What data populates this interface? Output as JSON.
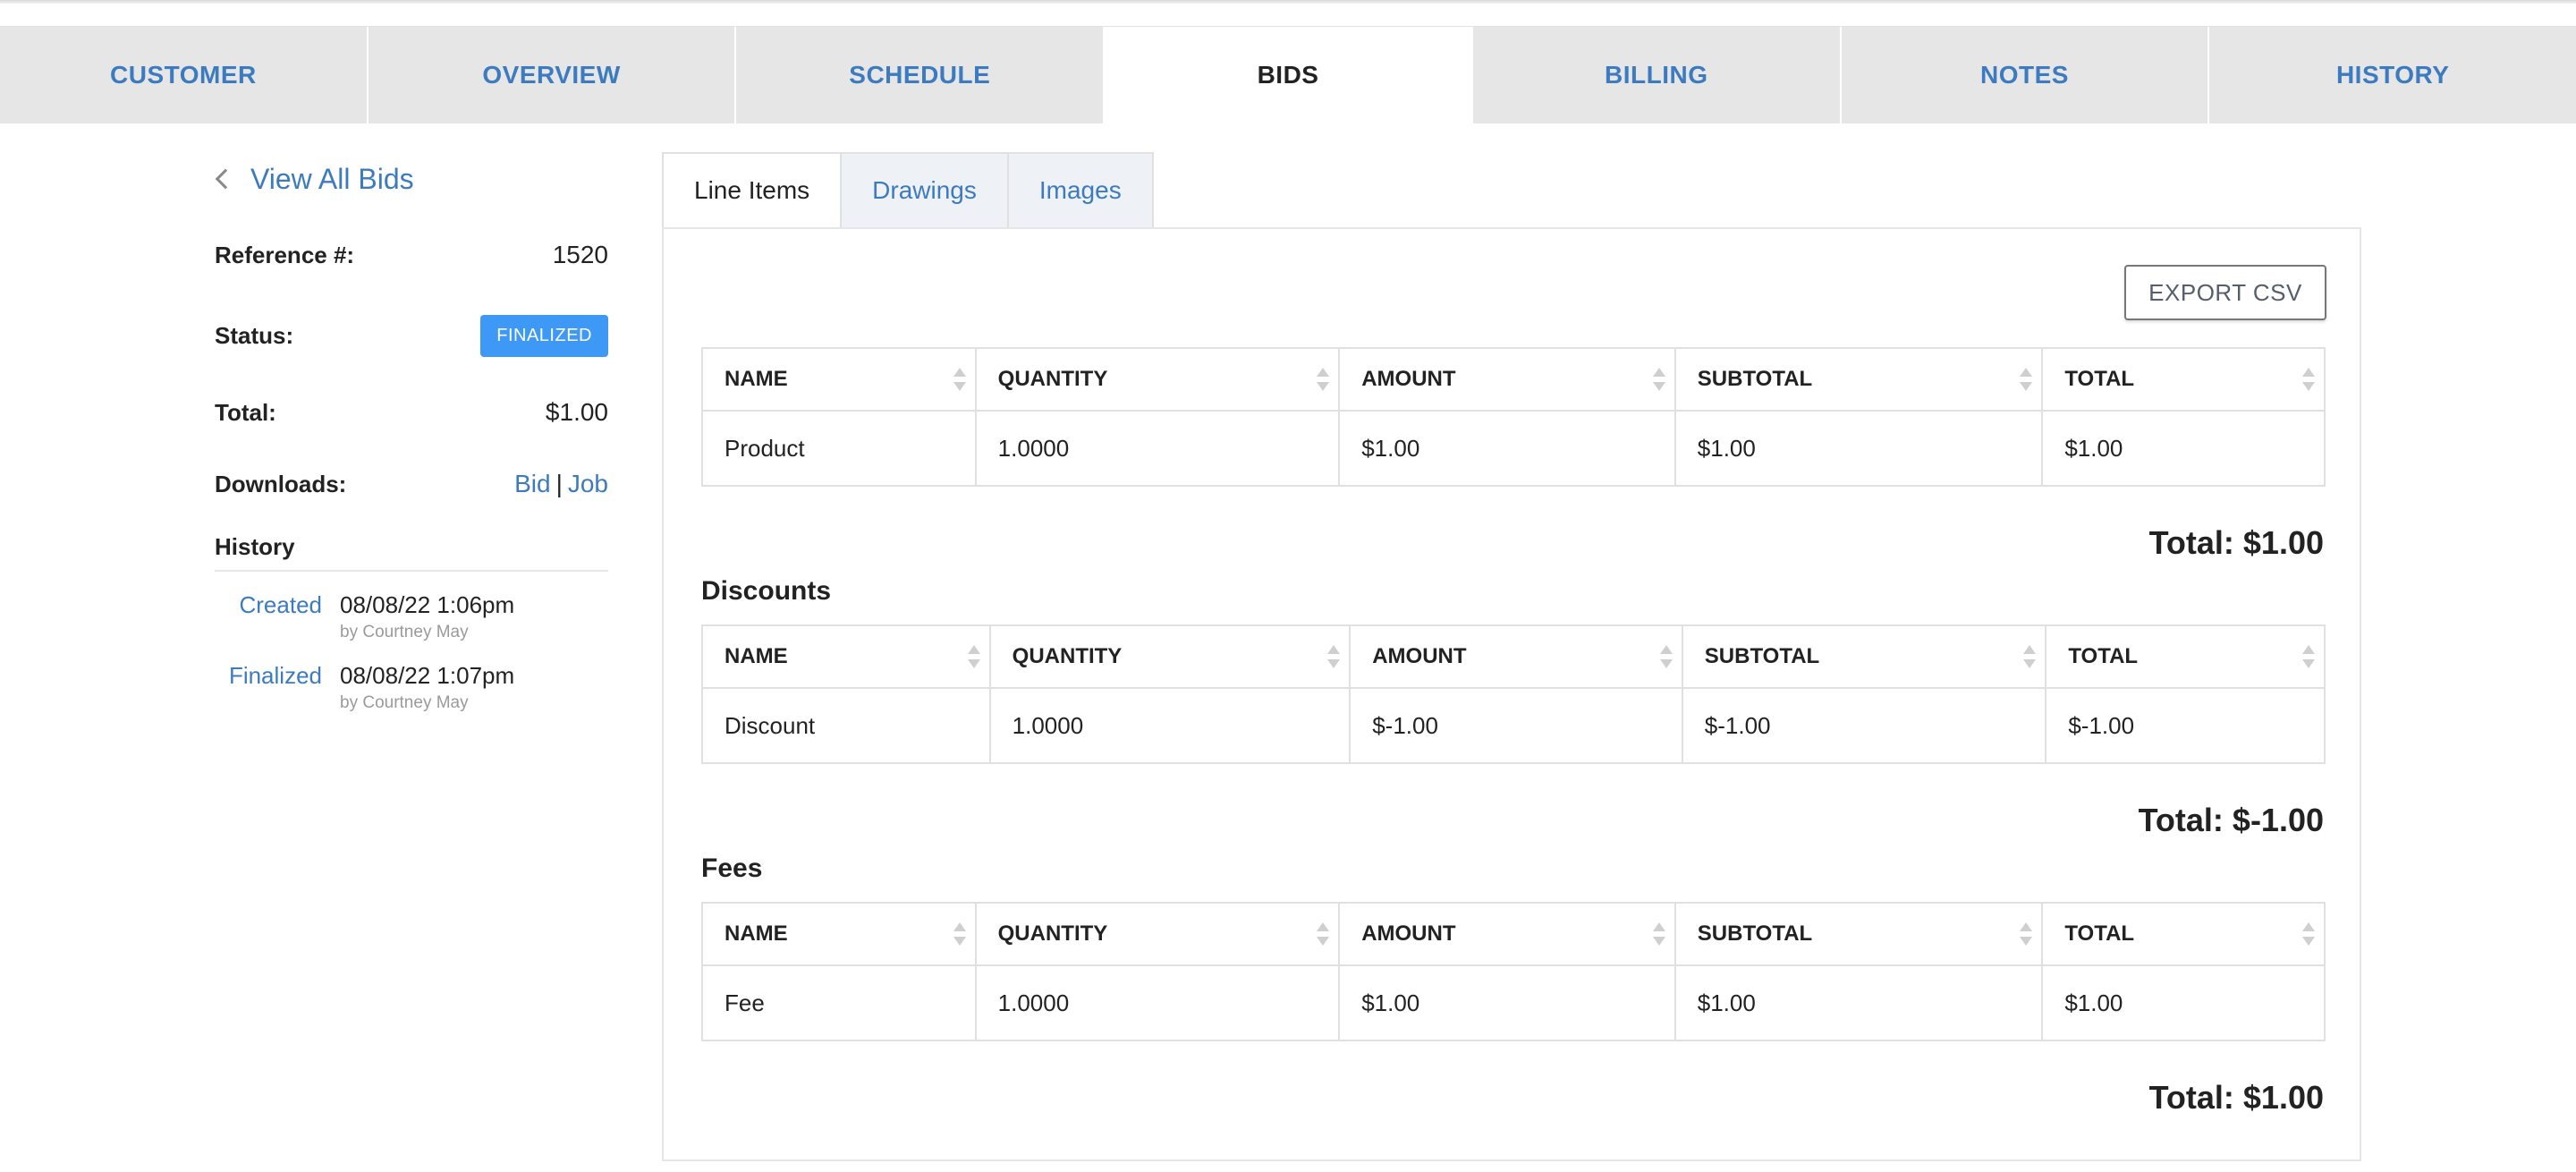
{
  "nav": {
    "tabs": [
      "CUSTOMER",
      "OVERVIEW",
      "SCHEDULE",
      "BIDS",
      "BILLING",
      "NOTES",
      "HISTORY"
    ],
    "active": "BIDS"
  },
  "left": {
    "back_label": "View All Bids",
    "reference_label": "Reference #:",
    "reference_value": "1520",
    "status_label": "Status:",
    "status_value": "FINALIZED",
    "total_label": "Total:",
    "total_value": "$1.00",
    "downloads_label": "Downloads:",
    "downloads_bid": "Bid",
    "downloads_sep": "|",
    "downloads_job": "Job",
    "history_title": "History",
    "history": [
      {
        "label": "Created",
        "date": "08/08/22 1:06pm",
        "by": "by Courtney May"
      },
      {
        "label": "Finalized",
        "date": "08/08/22 1:07pm",
        "by": "by Courtney May"
      }
    ]
  },
  "subtabs": [
    "Line Items",
    "Drawings",
    "Images"
  ],
  "export_label": "EXPORT CSV",
  "columns": [
    "NAME",
    "QUANTITY",
    "AMOUNT",
    "SUBTOTAL",
    "TOTAL"
  ],
  "line_items": {
    "rows": [
      [
        "Product",
        "1.0000",
        "$1.00",
        "$1.00",
        "$1.00"
      ]
    ],
    "total": "Total: $1.00"
  },
  "discounts": {
    "title": "Discounts",
    "rows": [
      [
        "Discount",
        "1.0000",
        "$-1.00",
        "$-1.00",
        "$-1.00"
      ]
    ],
    "total": "Total: $-1.00"
  },
  "fees": {
    "title": "Fees",
    "rows": [
      [
        "Fee",
        "1.0000",
        "$1.00",
        "$1.00",
        "$1.00"
      ]
    ],
    "total": "Total: $1.00"
  },
  "colors": {
    "accent": "#3d7bc0",
    "badge": "#3d99f5",
    "tab_bg": "#e6e6e6"
  }
}
